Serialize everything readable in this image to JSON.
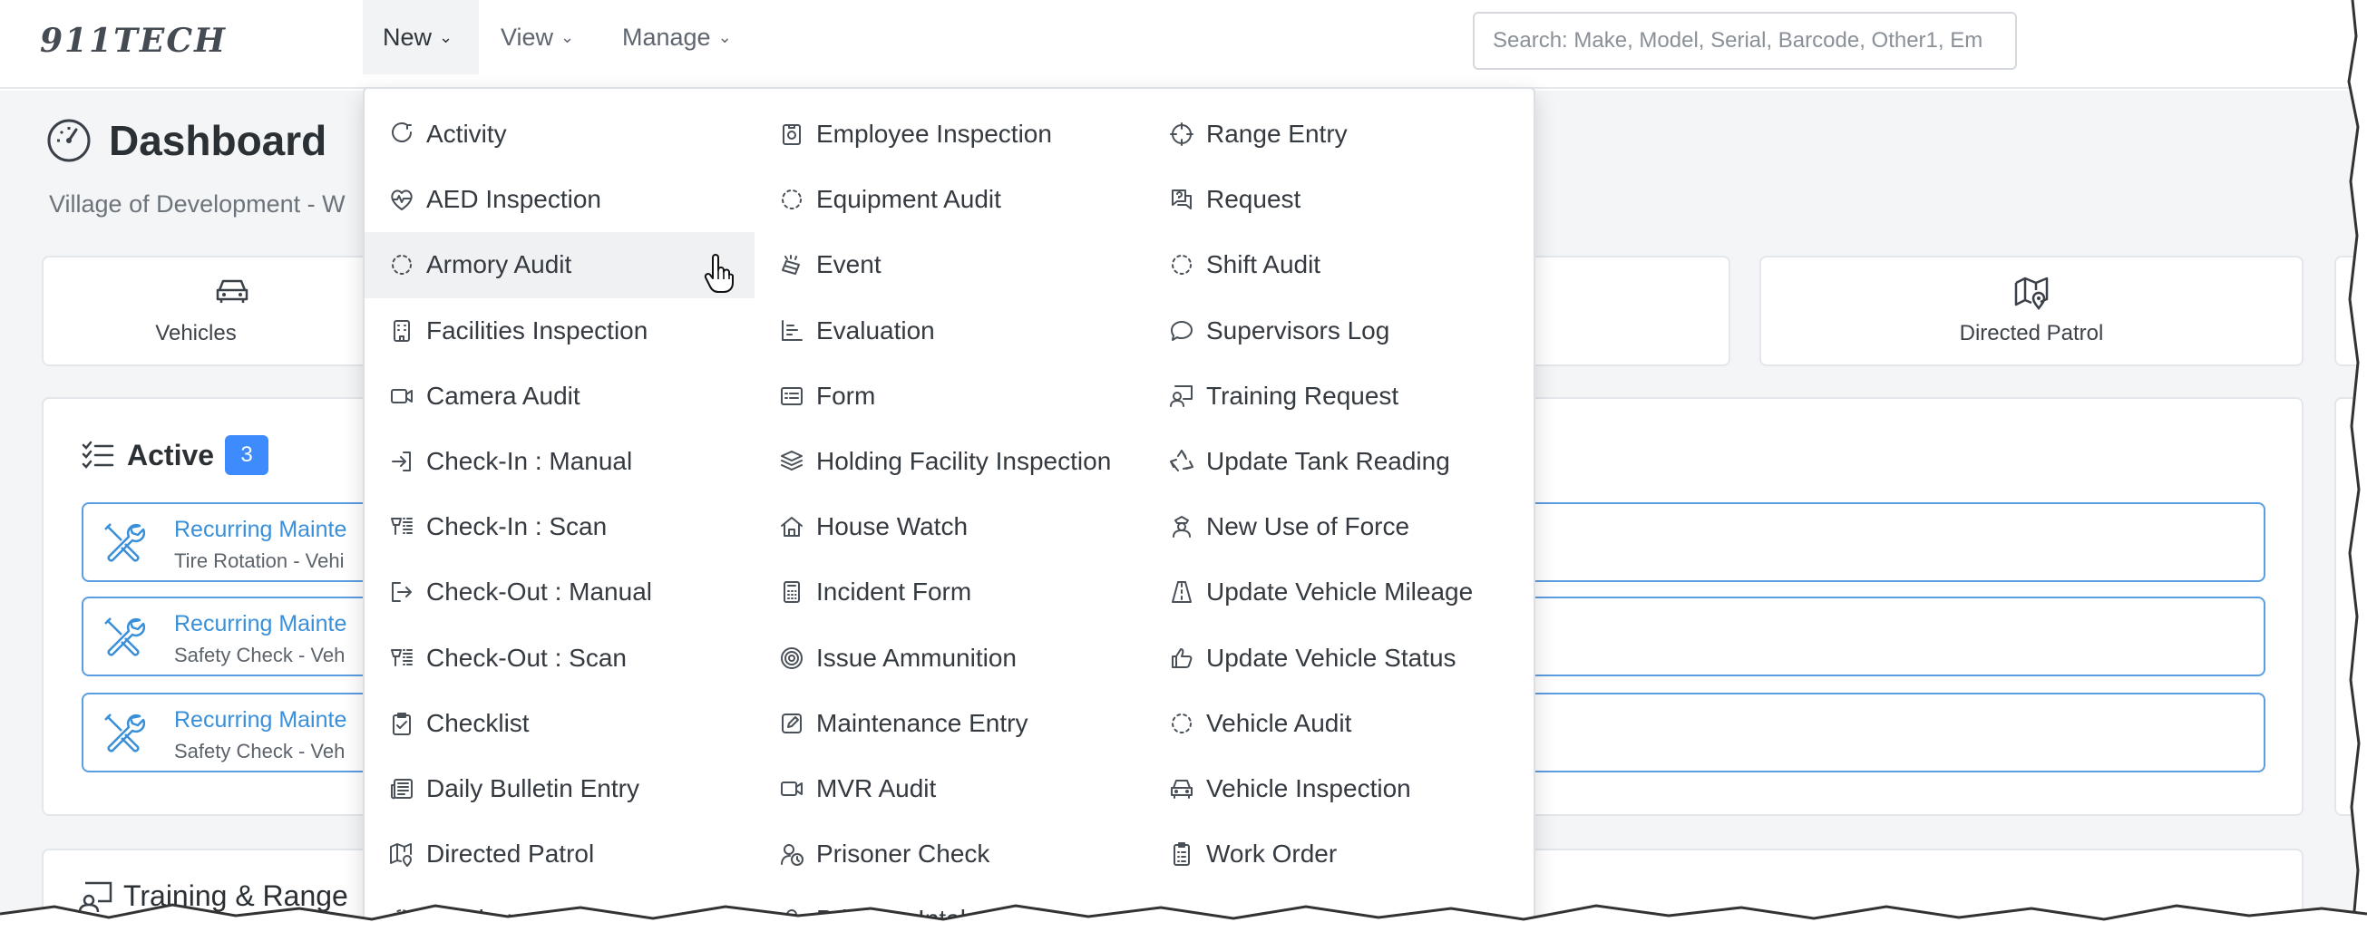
{
  "brand": {
    "logo_text": "911TECH"
  },
  "nav": {
    "items": [
      {
        "label": "New",
        "chevron": "⌄"
      },
      {
        "label": "View",
        "chevron": "⌄"
      },
      {
        "label": "Manage",
        "chevron": "⌄"
      }
    ]
  },
  "search": {
    "placeholder": "Search: Make, Model, Serial, Barcode, Other1, Em"
  },
  "dashboard": {
    "title": "Dashboard",
    "subtitle": "Village of Development - W",
    "quick_actions": [
      {
        "label": "Vehicles",
        "icon": "car-icon"
      },
      {
        "label": "Directed Patrol",
        "icon": "map-pin-icon"
      }
    ],
    "active": {
      "title": "Active",
      "count": "3",
      "tasks": [
        {
          "title": "Recurring Mainte",
          "subtitle": "Tire Rotation - Vehi"
        },
        {
          "title": "Recurring Mainte",
          "subtitle": "Safety Check - Veh"
        },
        {
          "title": "Recurring Mainte",
          "subtitle": "Safety Check - Veh"
        }
      ]
    },
    "training": {
      "title": "Training & Range"
    }
  },
  "dropdown": {
    "columns": [
      [
        {
          "label": "Activity",
          "icon": "activity-icon"
        },
        {
          "label": "AED Inspection",
          "icon": "heart-pulse-icon"
        },
        {
          "label": "Armory Audit",
          "icon": "dashed-circle-icon"
        },
        {
          "label": "Facilities Inspection",
          "icon": "building-icon"
        },
        {
          "label": "Camera Audit",
          "icon": "video-icon"
        },
        {
          "label": "Check-In : Manual",
          "icon": "sign-in-icon"
        },
        {
          "label": "Check-In : Scan",
          "icon": "barcode-scan-icon"
        },
        {
          "label": "Check-Out : Manual",
          "icon": "sign-out-icon"
        },
        {
          "label": "Check-Out : Scan",
          "icon": "barcode-scan-icon"
        },
        {
          "label": "Checklist",
          "icon": "clipboard-check-icon"
        },
        {
          "label": "Daily Bulletin Entry",
          "icon": "newspaper-icon"
        },
        {
          "label": "Directed Patrol",
          "icon": "map-pin-icon"
        },
        {
          "label": "Employee Audit",
          "icon": "dashed-circle-icon"
        }
      ],
      [
        {
          "label": "Employee Inspection",
          "icon": "id-badge-icon"
        },
        {
          "label": "Equipment Audit",
          "icon": "dashed-circle-icon"
        },
        {
          "label": "Event",
          "icon": "event-icon"
        },
        {
          "label": "Evaluation",
          "icon": "bar-chart-icon"
        },
        {
          "label": "Form",
          "icon": "form-icon"
        },
        {
          "label": "Holding Facility Inspection",
          "icon": "layers-icon"
        },
        {
          "label": "House Watch",
          "icon": "house-icon"
        },
        {
          "label": "Incident Form",
          "icon": "calculator-icon"
        },
        {
          "label": "Issue Ammunition",
          "icon": "target-icon"
        },
        {
          "label": "Maintenance Entry",
          "icon": "edit-icon"
        },
        {
          "label": "MVR Audit",
          "icon": "video-icon"
        },
        {
          "label": "Prisoner Check",
          "icon": "user-clock-icon"
        },
        {
          "label": "Prisoner Intake",
          "icon": "user-icon"
        }
      ],
      [
        {
          "label": "Range Entry",
          "icon": "crosshair-icon"
        },
        {
          "label": "Request",
          "icon": "question-chat-icon"
        },
        {
          "label": "Shift Audit",
          "icon": "dashed-circle-icon"
        },
        {
          "label": "Supervisors Log",
          "icon": "chat-bubble-icon"
        },
        {
          "label": "Training Request",
          "icon": "person-board-icon"
        },
        {
          "label": "Update Tank Reading",
          "icon": "recycle-icon"
        },
        {
          "label": "New Use of Force",
          "icon": "officer-icon"
        },
        {
          "label": "Update Vehicle Mileage",
          "icon": "road-icon"
        },
        {
          "label": "Update Vehicle Status",
          "icon": "thumbs-up-icon"
        },
        {
          "label": "Vehicle Audit",
          "icon": "dashed-circle-icon"
        },
        {
          "label": "Vehicle Inspection",
          "icon": "car-icon"
        },
        {
          "label": "Work Order",
          "icon": "clipboard-list-icon"
        }
      ]
    ],
    "hovered_item": "Armory Audit"
  }
}
